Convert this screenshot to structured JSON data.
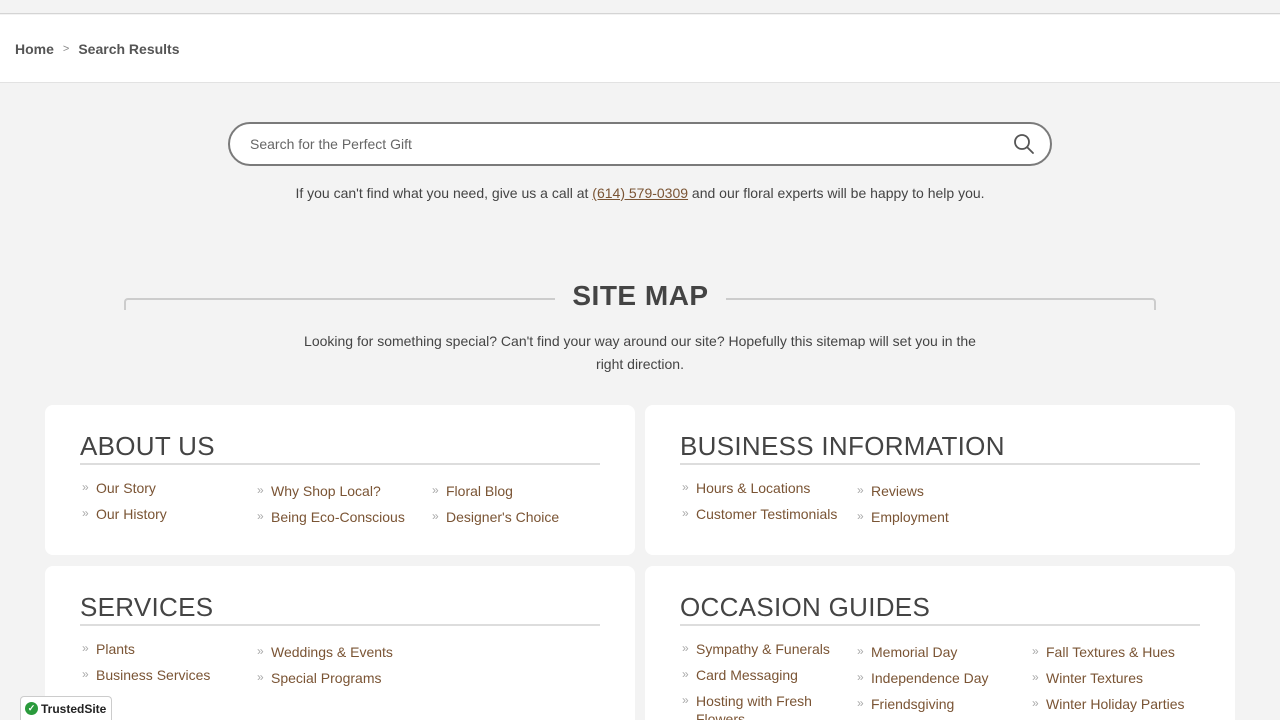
{
  "breadcrumb": {
    "home": "Home",
    "separator": ">",
    "current": "Search Results"
  },
  "search": {
    "placeholder": "Search for the Perfect Gift",
    "icon": "search-icon"
  },
  "help": {
    "before": "If you can't find what you need, give us a call at ",
    "phone": "(614) 579-0309",
    "after": " and our floral experts will be happy to help you."
  },
  "sitemap": {
    "title": "SITE MAP",
    "description": "Looking for something special? Can't find your way around our site? Hopefully this sitemap will set you in the right direction."
  },
  "sections": {
    "about": {
      "title": "ABOUT US",
      "col1": [
        "Our Story",
        "Our History"
      ],
      "col2": [
        "Why Shop Local?",
        "Being Eco-Conscious"
      ],
      "col3": [
        "Floral Blog",
        "Designer's Choice"
      ]
    },
    "business": {
      "title": "BUSINESS INFORMATION",
      "col1": [
        "Hours & Locations",
        "Customer Testimonials"
      ],
      "col2": [
        "Reviews",
        "Employment"
      ]
    },
    "services": {
      "title": "SERVICES",
      "col1": [
        "Plants",
        "Business Services"
      ],
      "col2": [
        "Weddings & Events",
        "Special Programs"
      ]
    },
    "occasions": {
      "title": "OCCASION GUIDES",
      "col1": [
        "Sympathy & Funerals",
        "Card Messaging",
        "Hosting with Fresh Flowers"
      ],
      "col2": [
        "Memorial Day",
        "Independence Day",
        "Friendsgiving"
      ],
      "col3": [
        "Fall Textures & Hues",
        "Winter Textures",
        "Winter Holiday Parties"
      ]
    }
  },
  "badge": {
    "label": "TrustedSite",
    "mark": "✓"
  },
  "colors": {
    "link": "#7a5434",
    "background": "#f3f3f3",
    "card": "#ffffff"
  }
}
